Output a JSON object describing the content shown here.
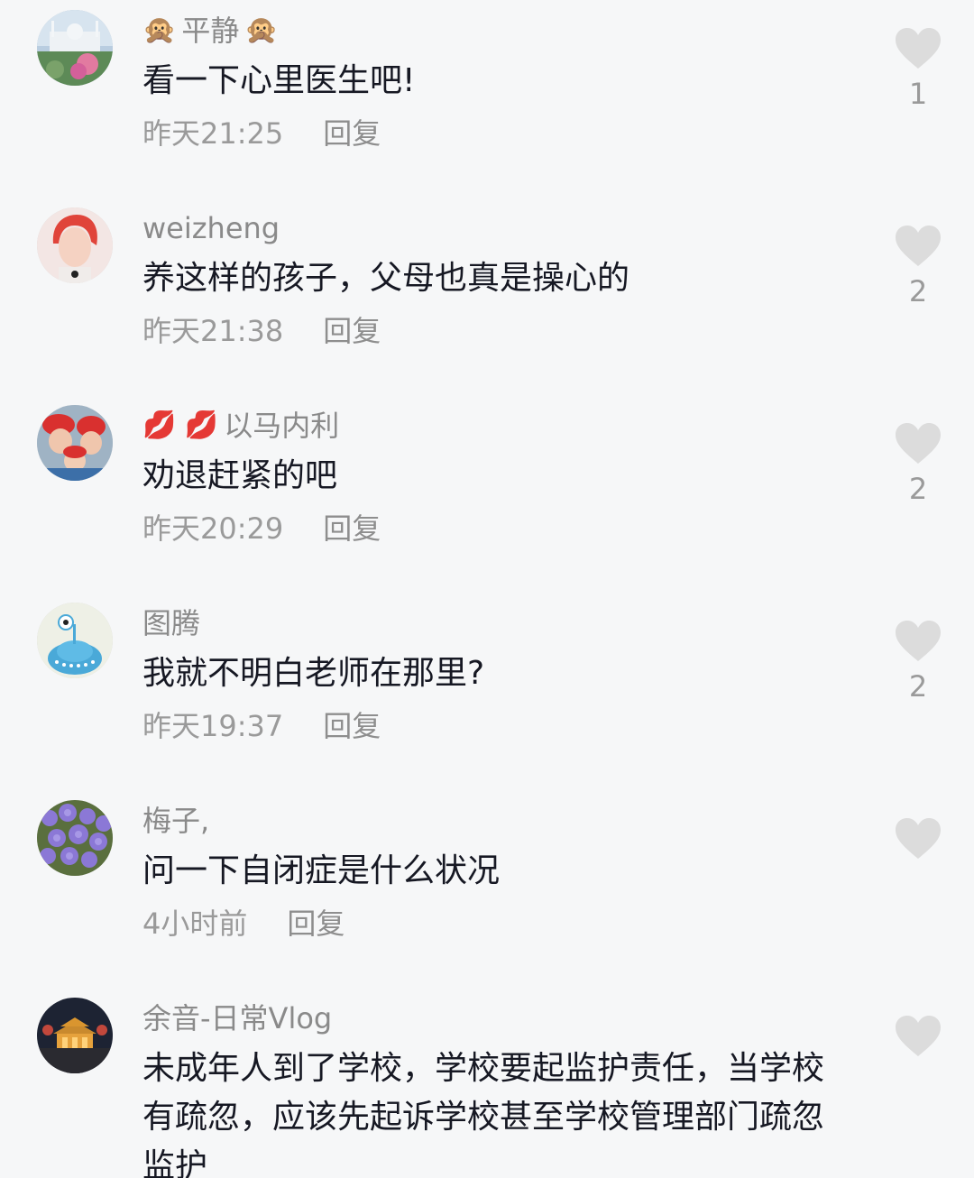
{
  "comments": [
    {
      "username": "平静",
      "username_prefix_emoji": "🙊",
      "username_suffix_emoji": "🙊",
      "text": "看一下心里医生吧!",
      "time": "昨天21:25",
      "reply_label": "回复",
      "like_count": "1",
      "avatar": "mosque-landscape"
    },
    {
      "username": "weizheng",
      "text": "养这样的孩子，父母也真是操心的",
      "time": "昨天21:38",
      "reply_label": "回复",
      "like_count": "2",
      "avatar": "red-hair-person"
    },
    {
      "username": "以马内利",
      "username_prefix_emoji": "💋 💋",
      "text": "劝退赶紧的吧",
      "time": "昨天20:29",
      "reply_label": "回复",
      "like_count": "2",
      "avatar": "family-red-hats"
    },
    {
      "username": "图腾",
      "text": "我就不明白老师在那里?",
      "time": "昨天19:37",
      "reply_label": "回复",
      "like_count": "2",
      "avatar": "blue-alien"
    },
    {
      "username": "梅子,",
      "text": "问一下自闭症是什么状况",
      "time": "4小时前",
      "reply_label": "回复",
      "like_count": "",
      "avatar": "purple-flowers"
    },
    {
      "username": "余音-日常Vlog",
      "text": "未成年人到了学校，学校要起监护责任，当学校有疏忽，应该先起诉学校甚至学校管理部门疏忽监护",
      "time": "",
      "reply_label": "",
      "like_count": "",
      "avatar": "night-pagoda"
    }
  ],
  "colors": {
    "background": "#f6f7f8",
    "username": "#8a8a8a",
    "text": "#161823",
    "meta": "#9a9a9a",
    "heart": "#dcdcdc"
  }
}
